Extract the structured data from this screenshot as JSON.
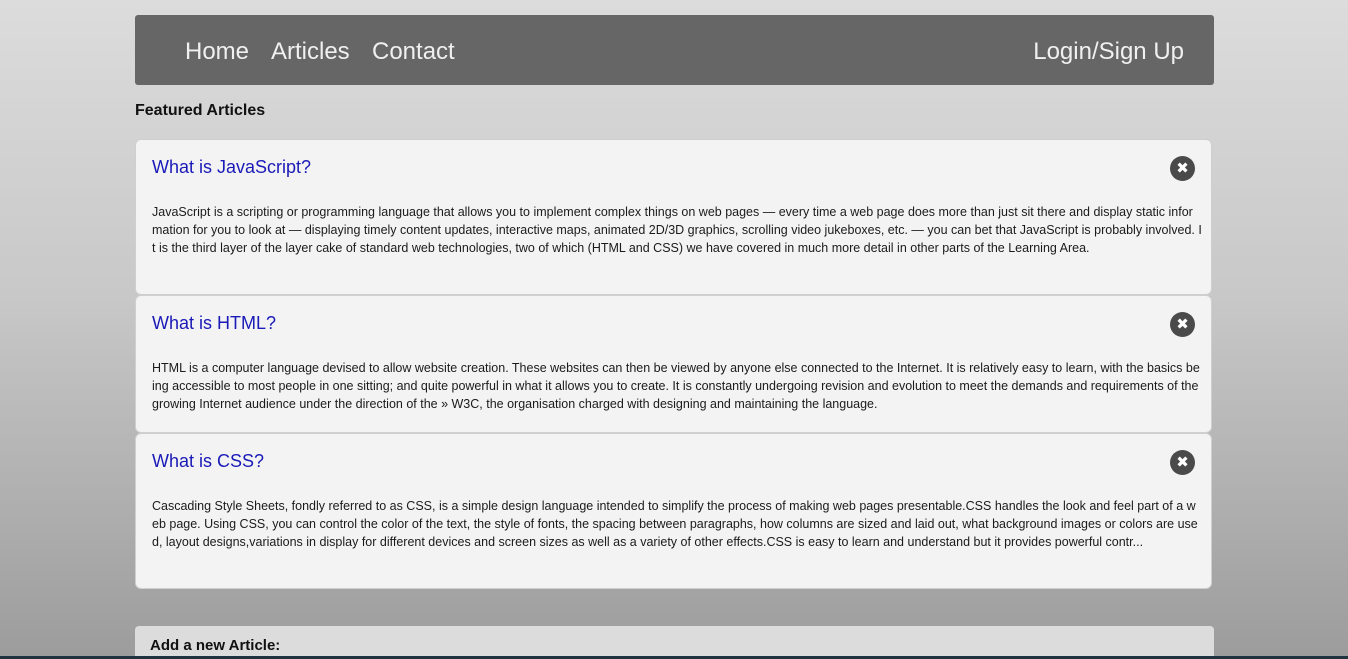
{
  "nav": {
    "home": "Home",
    "articles": "Articles",
    "contact": "Contact",
    "login": "Login/Sign Up"
  },
  "featured": {
    "title": "Featured Articles"
  },
  "articles": [
    {
      "title": "What is JavaScript?",
      "close_icon": "✖",
      "body": "JavaScript is a scripting or programming language that allows you to implement complex things on web pages — every time a web page does more than just sit there and display static information for you to look at — displaying timely content updates, interactive maps, animated 2D/3D graphics, scrolling video jukeboxes, etc. — you can bet that JavaScript is probably involved. It is the third layer of the layer cake of standard web technologies, two of which (HTML and CSS) we have covered in much more detail in other parts of the Learning Area."
    },
    {
      "title": "What is HTML?",
      "close_icon": "✖",
      "body": "HTML is a computer language devised to allow website creation. These websites can then be viewed by anyone else connected to the Internet. It is relatively easy to learn, with the basics being accessible to most people in one sitting; and quite powerful in what it allows you to create. It is constantly undergoing revision and evolution to meet the demands and requirements of the growing Internet audience under the direction of the » W3C, the organisation charged with designing and maintaining the language."
    },
    {
      "title": "What is CSS?",
      "close_icon": "✖",
      "body": "Cascading Style Sheets, fondly referred to as CSS, is a simple design language intended to simplify the process of making web pages presentable.CSS handles the look and feel part of a web page. Using CSS, you can control the color of the text, the style of fonts, the spacing between paragraphs, how columns are sized and laid out, what background images or colors are used, layout designs,variations in display for different devices and screen sizes as well as a variety of other effects.CSS is easy to learn and understand but it provides powerful contr..."
    }
  ],
  "add_article": {
    "title": "Add a new Article:"
  },
  "colors": {
    "navbar": "#666666",
    "link": "#1a1ab8",
    "card": "#f3f3f3"
  },
  "icons": {
    "close": "close-circle-icon"
  }
}
